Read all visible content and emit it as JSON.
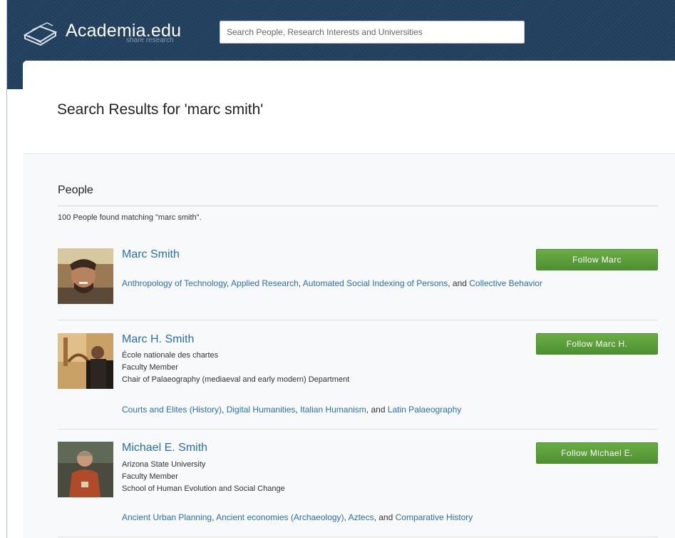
{
  "header": {
    "logo_text": "Academia.edu",
    "logo_tagline": "share research",
    "search_placeholder": "Search People, Research Interests and Universities",
    "bar_color": "#213f5f"
  },
  "page": {
    "title": "Search Results for 'marc smith'"
  },
  "people_section": {
    "heading": "People",
    "count_text": "100 People found matching \"marc smith\".",
    "separator": ", ",
    "and_word": ", and ",
    "people": [
      {
        "name": "Marc Smith",
        "details": [],
        "interests": [
          "Anthropology of Technology",
          "Applied Research",
          "Automated Social Indexing of Persons",
          "Collective Behavior"
        ],
        "follow_label": "Follow Marc"
      },
      {
        "name": "Marc H. Smith",
        "details": [
          "École nationale des chartes",
          "Faculty Member",
          "Chair of Palaeography (mediaeval and early modern) Department"
        ],
        "interests": [
          "Courts and Elites (History)",
          "Digital Humanities",
          "Italian Humanism",
          "Latin Palaeography"
        ],
        "follow_label": "Follow Marc H."
      },
      {
        "name": "Michael E. Smith",
        "details": [
          "Arizona State University",
          "Faculty Member",
          "School of Human Evolution and Social Change"
        ],
        "interests": [
          "Ancient Urban Planning",
          "Ancient economies (Archaeology)",
          "Aztecs",
          "Comparative History"
        ],
        "follow_label": "Follow Michael E."
      }
    ]
  },
  "colors": {
    "link": "#2a6fb5",
    "follow_button": "#5a9e3a"
  }
}
